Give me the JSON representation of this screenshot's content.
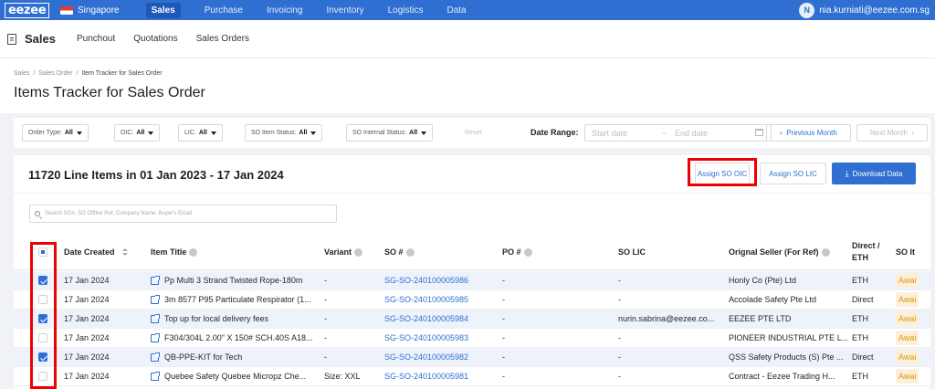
{
  "topnav": {
    "logo": "eezee",
    "country": "Singapore",
    "items": [
      "Sales",
      "Purchase",
      "Invoicing",
      "Inventory",
      "Logistics",
      "Data"
    ],
    "active": "Sales",
    "user_initial": "N",
    "user_email": "nia.kurniati@eezee.com.sg"
  },
  "subnav": {
    "title": "Sales",
    "items": [
      "Punchout",
      "Quotations",
      "Sales Orders"
    ]
  },
  "breadcrumb": [
    "Sales",
    "Sales Order",
    "Item Tracker for Sales Order"
  ],
  "page_title": "Items Tracker for Sales Order",
  "filters": {
    "order_type": {
      "label": "Order Type:",
      "value": "All"
    },
    "oic": {
      "label": "OIC:",
      "value": "All"
    },
    "lic": {
      "label": "LIC:",
      "value": "All"
    },
    "so_item_status": {
      "label": "SO Item Status:",
      "value": "All"
    },
    "so_internal_status": {
      "label": "SO Internal Status:",
      "value": "All"
    },
    "reset": "Reset",
    "date_range_label": "Date Range:",
    "start_placeholder": "Start date",
    "separator": "~",
    "end_placeholder": "End date",
    "prev_month": "Previous Month",
    "next_month": "Next Month"
  },
  "card": {
    "title": "11720 Line Items in 01 Jan 2023 - 17 Jan 2024",
    "assign_oic": "Assign SO OIC",
    "assign_lic": "Assign SO LIC",
    "download": "Download Data",
    "search_placeholder": "Search SO#, SO Offline Ref, Company Name, Buyer's Email"
  },
  "table": {
    "headers": {
      "date": "Date Created",
      "item": "Item Title",
      "variant": "Variant",
      "so": "SO #",
      "po": "PO #",
      "lic": "SO LIC",
      "seller": "Orignal Seller (For Ref)",
      "direct_line1": "Direct /",
      "direct_line2": "ETH",
      "so_item": "SO It"
    },
    "rows": [
      {
        "date": "17 Jan 2024",
        "item": "Pp Multi 3 Strand Twisted Rope-180m",
        "variant": "-",
        "so": "SG-SO-240100005986",
        "po": "-",
        "lic": "-",
        "seller": "Honly Co (Pte) Ltd",
        "direct": "ETH",
        "status": "Awai",
        "checked": true
      },
      {
        "date": "17 Jan 2024",
        "item": "3m 8577 P95 Particulate Respirator (1...",
        "variant": "-",
        "so": "SG-SO-240100005985",
        "po": "-",
        "lic": "-",
        "seller": "Accolade Safety Pte Ltd",
        "direct": "Direct",
        "status": "Awai",
        "checked": false
      },
      {
        "date": "17 Jan 2024",
        "item": "Top up for local delivery fees",
        "variant": "-",
        "so": "SG-SO-240100005984",
        "po": "-",
        "lic": "nurin.sabrina@eezee.co...",
        "seller": "EEZEE PTE LTD",
        "direct": "ETH",
        "status": "Awai",
        "checked": true
      },
      {
        "date": "17 Jan 2024",
        "item": "F304/304L 2.00\" X 150# SCH.40S A18...",
        "variant": "-",
        "so": "SG-SO-240100005983",
        "po": "-",
        "lic": "-",
        "seller": "PIONEER INDUSTRIAL PTE L...",
        "direct": "ETH",
        "status": "Awai",
        "checked": false
      },
      {
        "date": "17 Jan 2024",
        "item": "QB-PPE-KIT for Tech",
        "variant": "-",
        "so": "SG-SO-240100005982",
        "po": "-",
        "lic": "-",
        "seller": "QSS Safety Products (S) Pte ...",
        "direct": "Direct",
        "status": "Awai",
        "checked": true
      },
      {
        "date": "17 Jan 2024",
        "item": "Quebee Safety Quebee Micropz Che...",
        "variant": "Size: XXL",
        "so": "SG-SO-240100005981",
        "po": "-",
        "lic": "-",
        "seller": "Contract - Eezee Trading H...",
        "direct": "ETH",
        "status": "Awai",
        "checked": false
      }
    ]
  },
  "colors": {
    "primary": "#2f6fd1",
    "highlight": "#ee0000",
    "status_bg": "#fdf0d8",
    "status_text": "#d89614"
  }
}
